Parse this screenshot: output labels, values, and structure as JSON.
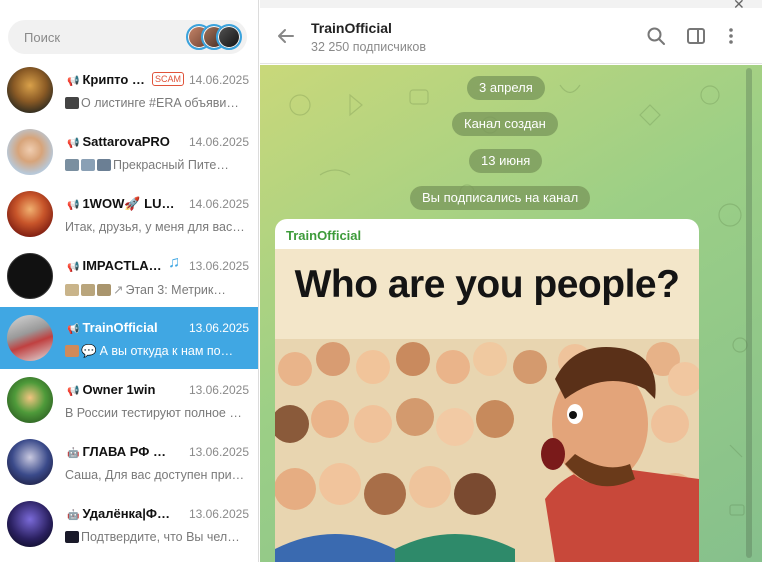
{
  "search": {
    "placeholder": "Поиск"
  },
  "chats": [
    {
      "title": "Крипто …",
      "badge": "SCAM",
      "date": "14.06.2025",
      "preview": "О листинге #ERA объяви…",
      "active": false
    },
    {
      "title": "SattarovaPRO",
      "date": "14.06.2025",
      "preview": "Прекрасный Пите…",
      "active": false
    },
    {
      "title": "1WOW🚀 LU…",
      "date": "14.06.2025",
      "preview": "Итак, друзья, у меня для вас…",
      "active": false
    },
    {
      "title": "IMPACTLA…",
      "date": "13.06.2025",
      "preview": "Этап 3: Метрик…",
      "active": false
    },
    {
      "title": "TrainOfficial",
      "date": "13.06.2025",
      "preview": "А вы откуда к нам по…",
      "active": true
    },
    {
      "title": "Owner 1win",
      "date": "13.06.2025",
      "preview": "В России тестируют полное …",
      "active": false
    },
    {
      "title": "ГЛАВА РФ …",
      "date": "13.06.2025",
      "preview": "Саша, Для вас доступен при…",
      "active": false
    },
    {
      "title": "Удалёнка|Ф…",
      "date": "13.06.2025",
      "preview": "Подтвердите, что Вы чел…",
      "active": false
    }
  ],
  "header": {
    "title": "TrainOfficial",
    "subscribers": "32 250 подписчиков"
  },
  "service_messages": [
    "3 апреля",
    "Канал создан",
    "13 июня",
    "Вы подписались на канал"
  ],
  "post": {
    "author": "TrainOfficial",
    "image_caption": "Who are you people?"
  },
  "icons": {
    "back": "arrow-left-icon",
    "search": "search-icon",
    "sidebar": "sidebar-toggle-icon",
    "menu": "more-vertical-icon",
    "channel": "megaphone-icon"
  },
  "colors": {
    "accent": "#40a7e3",
    "author": "#3d9b3a",
    "scam": "#e0533a"
  }
}
